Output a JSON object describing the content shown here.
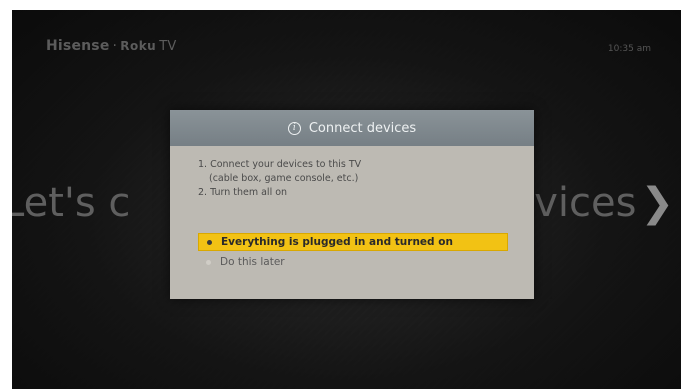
{
  "header": {
    "brand_primary": "Hisense",
    "brand_separator": "·",
    "brand_secondary": "Roku",
    "brand_tv": "TV",
    "clock": "10:35 am"
  },
  "background": {
    "heading_left": "Let's c",
    "heading_right": "vices",
    "chevron": "❯"
  },
  "dialog": {
    "icon": "info-icon",
    "title": "Connect devices",
    "steps": [
      "1. Connect your devices to this TV",
      "(cable box, game console, etc.)",
      "2. Turn them all on"
    ],
    "options": [
      {
        "label": "Everything is plugged in and turned on",
        "selected": true
      },
      {
        "label": "Do this later",
        "selected": false
      }
    ]
  },
  "colors": {
    "highlight": "#f2c214",
    "dialog_bg": "#bdbab3",
    "dialog_header": "#7e878d"
  }
}
